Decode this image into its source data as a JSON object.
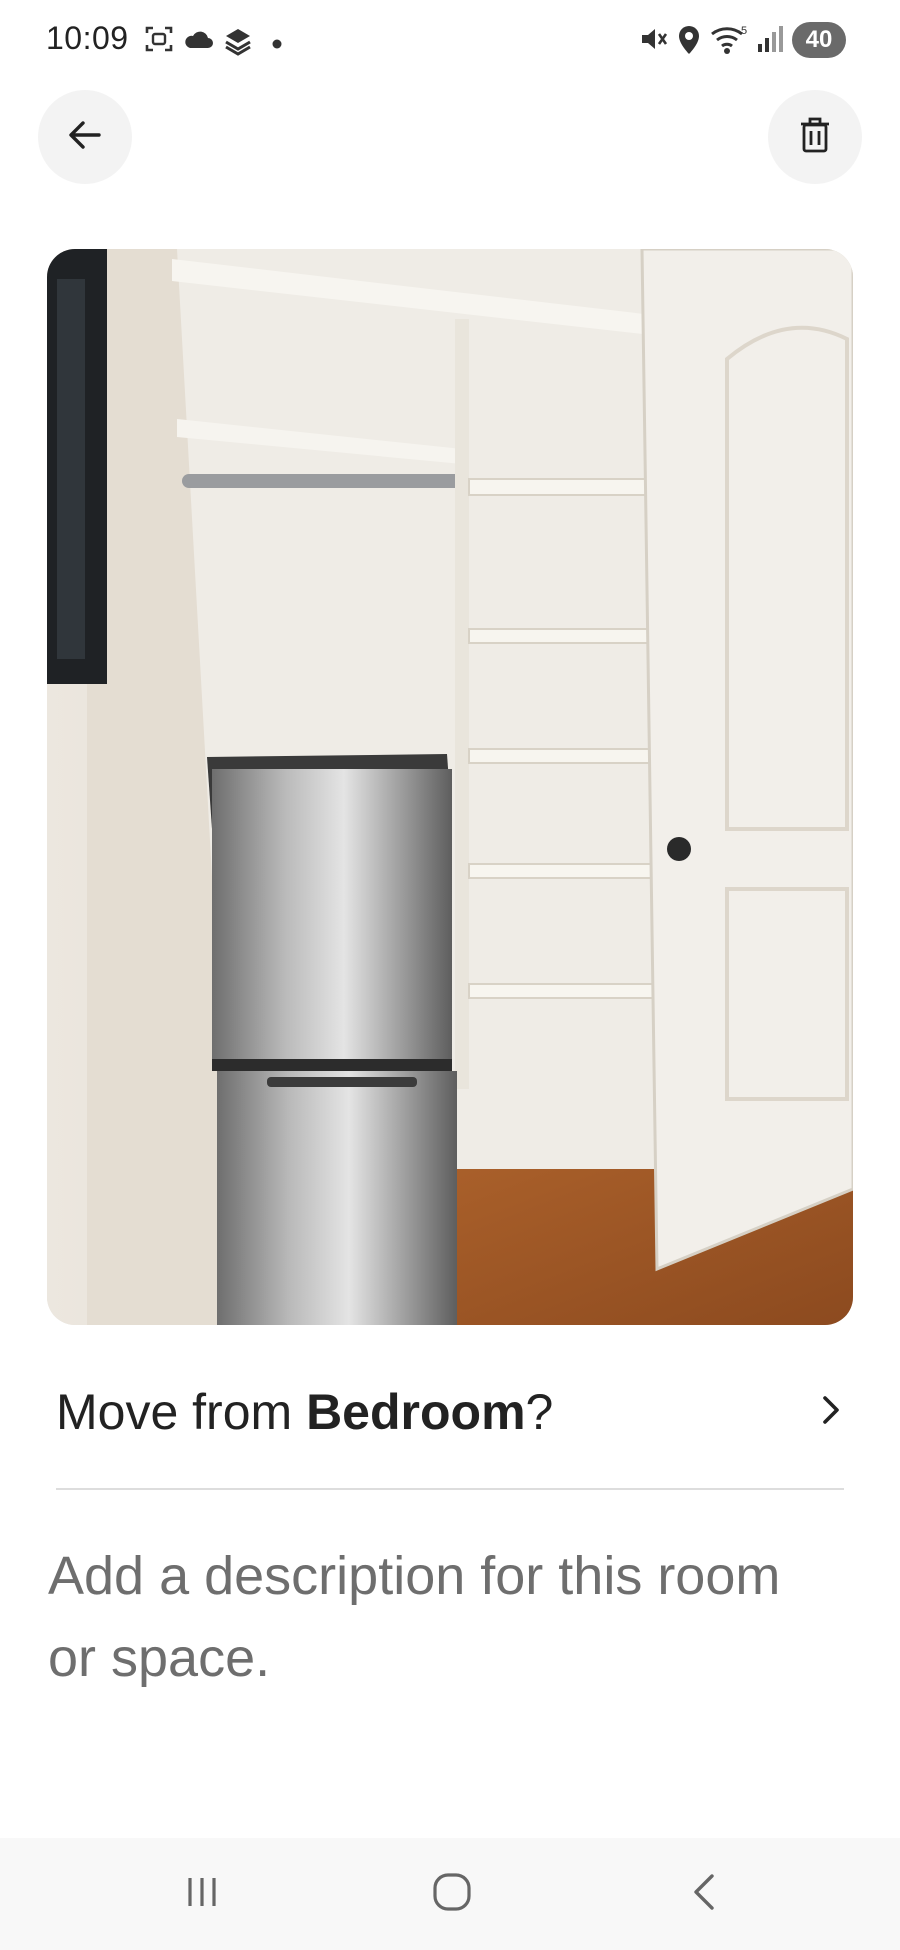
{
  "status_bar": {
    "time": "10:09",
    "battery": "40",
    "left_icons": [
      "screenshot-icon",
      "cloud-icon",
      "stack-icon",
      "dot-icon"
    ],
    "right_icons": [
      "mute-icon",
      "location-icon",
      "wifi-icon",
      "signal-icon"
    ]
  },
  "header": {
    "back_icon": "arrow-left-icon",
    "delete_icon": "trash-icon"
  },
  "photo": {
    "subject": "closet-with-refrigerator-photo"
  },
  "move_row": {
    "prefix": "Move from ",
    "room": "Bedroom",
    "suffix": "?",
    "chevron_icon": "chevron-right-icon"
  },
  "description": {
    "placeholder": "Add a description for this room or space."
  },
  "nav_bar": {
    "recents_icon": "recents-icon",
    "home_icon": "home-icon",
    "back_icon": "nav-back-icon"
  },
  "colors": {
    "text_primary": "#222222",
    "text_secondary": "#6e6e6e",
    "button_bg": "#f3f3f3",
    "divider": "#dddddd"
  }
}
